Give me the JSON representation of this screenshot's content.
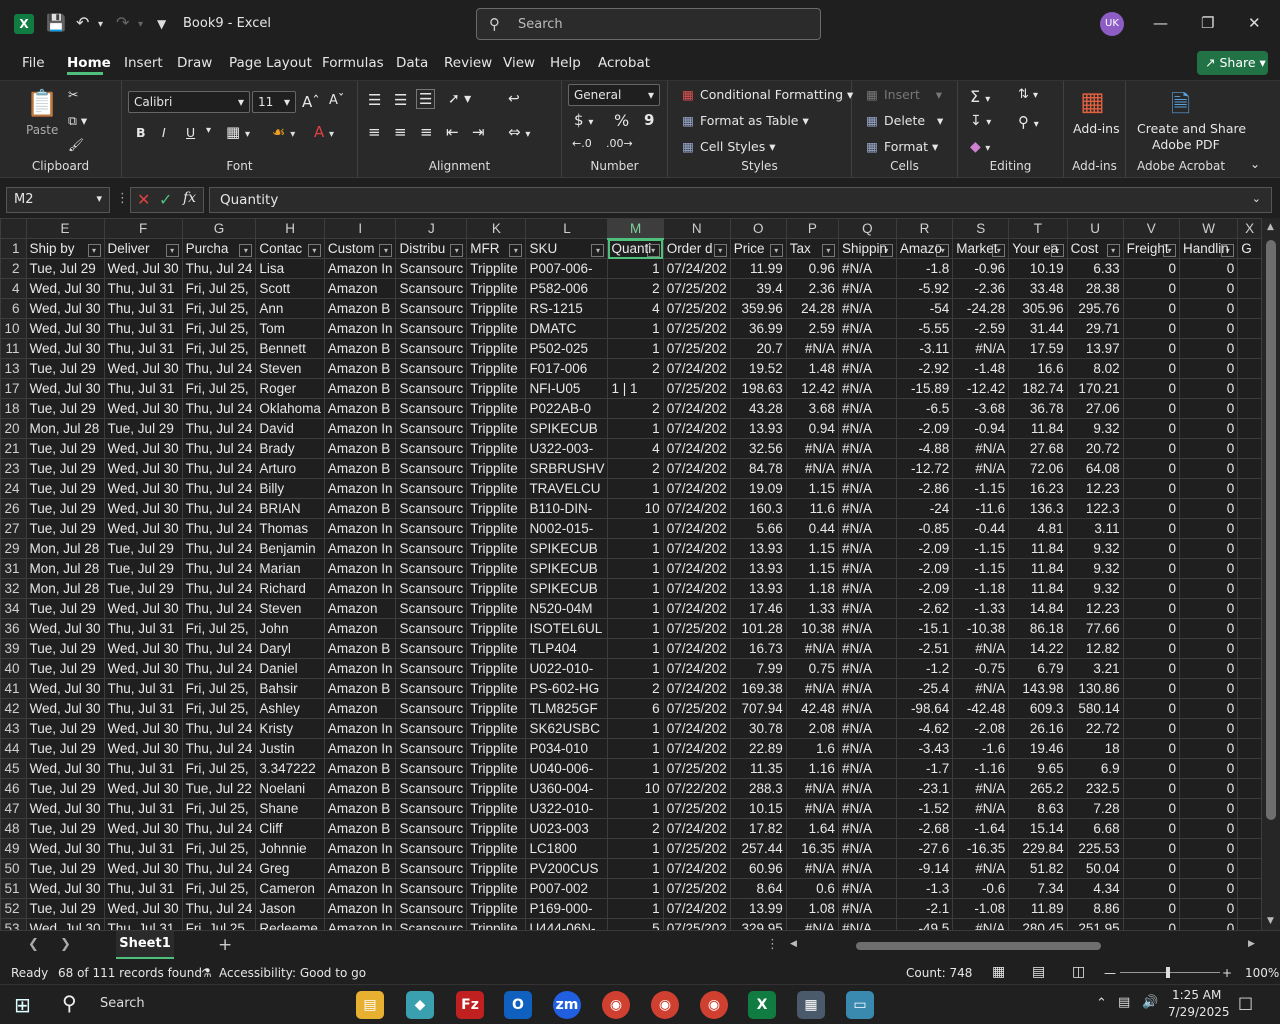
{
  "titlebar": {
    "app_logo": "X",
    "doc_title": "Book9  -  Excel",
    "search_placeholder": "Search",
    "avatar": "UK"
  },
  "menu": {
    "tabs": [
      "File",
      "Home",
      "Insert",
      "Draw",
      "Page Layout",
      "Formulas",
      "Data",
      "Review",
      "View",
      "Help",
      "Acrobat"
    ],
    "share": "Share"
  },
  "ribbon": {
    "clipboard": {
      "paste": "Paste",
      "label": "Clipboard"
    },
    "font": {
      "name": "Calibri",
      "size": "11",
      "bold": "B",
      "italic": "I",
      "underline": "U",
      "label": "Font"
    },
    "alignment": {
      "label": "Alignment"
    },
    "number": {
      "format": "General",
      "currency": "$",
      "percent": "%",
      "comma": "9",
      "label": "Number"
    },
    "styles": {
      "conditional": "Conditional Formatting",
      "format_table": "Format as Table",
      "cell_styles": "Cell Styles",
      "label": "Styles"
    },
    "cells": {
      "insert": "Insert",
      "delete": "Delete",
      "format": "Format",
      "label": "Cells"
    },
    "editing": {
      "label": "Editing"
    },
    "addins": {
      "button": "Add-ins",
      "label": "Add-ins"
    },
    "acrobat": {
      "button_line1": "Create and Share",
      "button_line2": "Adobe PDF",
      "label": "Adobe Acrobat"
    }
  },
  "formula": {
    "namebox": "M2",
    "fx": "fx",
    "value": "Quantity"
  },
  "grid": {
    "columns": [
      "E",
      "F",
      "G",
      "H",
      "I",
      "J",
      "K",
      "L",
      "M",
      "N",
      "O",
      "P",
      "Q",
      "R",
      "S",
      "T",
      "U",
      "V",
      "W",
      "X"
    ],
    "header_row_num": "1",
    "headers": [
      "Ship by",
      "Deliver",
      "Purcha",
      "Contac",
      "Custom",
      "Distribu",
      "MFR",
      "SKU",
      "Quanti",
      "Order d",
      "Price",
      "Tax",
      "Shippin",
      "Amazo",
      "Market",
      "Your ea",
      "Cost",
      "Freight",
      "Handlin",
      "G"
    ],
    "rows": [
      [
        "2",
        "Tue, Jul 29",
        "Wed, Jul 30",
        "Thu, Jul 24",
        "Lisa",
        "Amazon In",
        "Scansourc",
        "Tripplite",
        "P007-006-",
        "1",
        "07/24/202",
        "11.99",
        "0.96",
        "#N/A",
        "-1.8",
        "-0.96",
        "10.19",
        "6.33",
        "0",
        "0"
      ],
      [
        "4",
        "Wed, Jul 30",
        "Thu, Jul 31",
        "Fri, Jul 25,",
        "Scott",
        "Amazon",
        "Scansourc",
        "Tripplite",
        "P582-006",
        "2",
        "07/25/202",
        "39.4",
        "2.36",
        "#N/A",
        "-5.92",
        "-2.36",
        "33.48",
        "28.38",
        "0",
        "0"
      ],
      [
        "6",
        "Wed, Jul 30",
        "Thu, Jul 31",
        "Fri, Jul 25,",
        "Ann",
        "Amazon B",
        "Scansourc",
        "Tripplite",
        "RS-1215",
        "4",
        "07/25/202",
        "359.96",
        "24.28",
        "#N/A",
        "-54",
        "-24.28",
        "305.96",
        "295.76",
        "0",
        "0"
      ],
      [
        "10",
        "Wed, Jul 30",
        "Thu, Jul 31",
        "Fri, Jul 25,",
        "Tom",
        "Amazon In",
        "Scansourc",
        "Tripplite",
        "DMATC",
        "1",
        "07/25/202",
        "36.99",
        "2.59",
        "#N/A",
        "-5.55",
        "-2.59",
        "31.44",
        "29.71",
        "0",
        "0"
      ],
      [
        "11",
        "Wed, Jul 30",
        "Thu, Jul 31",
        "Fri, Jul 25,",
        "Bennett",
        "Amazon B",
        "Scansourc",
        "Tripplite",
        "P502-025",
        "1",
        "07/25/202",
        "20.7",
        "#N/A",
        "#N/A",
        "-3.11",
        "#N/A",
        "17.59",
        "13.97",
        "0",
        "0"
      ],
      [
        "13",
        "Tue, Jul 29",
        "Wed, Jul 30",
        "Thu, Jul 24",
        "Steven",
        "Amazon B",
        "Scansourc",
        "Tripplite",
        "F017-006",
        "2",
        "07/24/202",
        "19.52",
        "1.48",
        "#N/A",
        "-2.92",
        "-1.48",
        "16.6",
        "8.02",
        "0",
        "0"
      ],
      [
        "17",
        "Wed, Jul 30",
        "Thu, Jul 31",
        "Fri, Jul 25,",
        "Roger",
        "Amazon B",
        "Scansourc",
        "Tripplite",
        "NFI-U05",
        "1 | 1",
        "07/25/202",
        "198.63",
        "12.42",
        "#N/A",
        "-15.89",
        "-12.42",
        "182.74",
        "170.21",
        "0",
        "0"
      ],
      [
        "18",
        "Tue, Jul 29",
        "Wed, Jul 30",
        "Thu, Jul 24",
        "Oklahoma",
        "Amazon B",
        "Scansourc",
        "Tripplite",
        "P022AB-0",
        "2",
        "07/24/202",
        "43.28",
        "3.68",
        "#N/A",
        "-6.5",
        "-3.68",
        "36.78",
        "27.06",
        "0",
        "0"
      ],
      [
        "20",
        "Mon, Jul 28",
        "Tue, Jul 29",
        "Thu, Jul 24",
        "David",
        "Amazon In",
        "Scansourc",
        "Tripplite",
        "SPIKECUB",
        "1",
        "07/24/202",
        "13.93",
        "0.94",
        "#N/A",
        "-2.09",
        "-0.94",
        "11.84",
        "9.32",
        "0",
        "0"
      ],
      [
        "21",
        "Tue, Jul 29",
        "Wed, Jul 30",
        "Thu, Jul 24",
        "Brady",
        "Amazon B",
        "Scansourc",
        "Tripplite",
        "U322-003-",
        "4",
        "07/24/202",
        "32.56",
        "#N/A",
        "#N/A",
        "-4.88",
        "#N/A",
        "27.68",
        "20.72",
        "0",
        "0"
      ],
      [
        "23",
        "Tue, Jul 29",
        "Wed, Jul 30",
        "Thu, Jul 24",
        "Arturo",
        "Amazon B",
        "Scansourc",
        "Tripplite",
        "SRBRUSHV",
        "2",
        "07/24/202",
        "84.78",
        "#N/A",
        "#N/A",
        "-12.72",
        "#N/A",
        "72.06",
        "64.08",
        "0",
        "0"
      ],
      [
        "24",
        "Tue, Jul 29",
        "Wed, Jul 30",
        "Thu, Jul 24",
        "Billy",
        "Amazon In",
        "Scansourc",
        "Tripplite",
        "TRAVELCU",
        "1",
        "07/24/202",
        "19.09",
        "1.15",
        "#N/A",
        "-2.86",
        "-1.15",
        "16.23",
        "12.23",
        "0",
        "0"
      ],
      [
        "26",
        "Tue, Jul 29",
        "Wed, Jul 30",
        "Thu, Jul 24",
        "BRIAN",
        "Amazon B",
        "Scansourc",
        "Tripplite",
        "B110-DIN-",
        "10",
        "07/24/202",
        "160.3",
        "11.6",
        "#N/A",
        "-24",
        "-11.6",
        "136.3",
        "122.3",
        "0",
        "0"
      ],
      [
        "27",
        "Tue, Jul 29",
        "Wed, Jul 30",
        "Thu, Jul 24",
        "Thomas",
        "Amazon In",
        "Scansourc",
        "Tripplite",
        "N002-015-",
        "1",
        "07/24/202",
        "5.66",
        "0.44",
        "#N/A",
        "-0.85",
        "-0.44",
        "4.81",
        "3.11",
        "0",
        "0"
      ],
      [
        "29",
        "Mon, Jul 28",
        "Tue, Jul 29",
        "Thu, Jul 24",
        "Benjamin",
        "Amazon In",
        "Scansourc",
        "Tripplite",
        "SPIKECUB",
        "1",
        "07/24/202",
        "13.93",
        "1.15",
        "#N/A",
        "-2.09",
        "-1.15",
        "11.84",
        "9.32",
        "0",
        "0"
      ],
      [
        "31",
        "Mon, Jul 28",
        "Tue, Jul 29",
        "Thu, Jul 24",
        "Marian",
        "Amazon In",
        "Scansourc",
        "Tripplite",
        "SPIKECUB",
        "1",
        "07/24/202",
        "13.93",
        "1.15",
        "#N/A",
        "-2.09",
        "-1.15",
        "11.84",
        "9.32",
        "0",
        "0"
      ],
      [
        "32",
        "Mon, Jul 28",
        "Tue, Jul 29",
        "Thu, Jul 24",
        "Richard",
        "Amazon In",
        "Scansourc",
        "Tripplite",
        "SPIKECUB",
        "1",
        "07/24/202",
        "13.93",
        "1.18",
        "#N/A",
        "-2.09",
        "-1.18",
        "11.84",
        "9.32",
        "0",
        "0"
      ],
      [
        "34",
        "Tue, Jul 29",
        "Wed, Jul 30",
        "Thu, Jul 24",
        "Steven",
        "Amazon",
        "Scansourc",
        "Tripplite",
        "N520-04M",
        "1",
        "07/24/202",
        "17.46",
        "1.33",
        "#N/A",
        "-2.62",
        "-1.33",
        "14.84",
        "12.23",
        "0",
        "0"
      ],
      [
        "36",
        "Wed, Jul 30",
        "Thu, Jul 31",
        "Fri, Jul 25,",
        "John",
        "Amazon",
        "Scansourc",
        "Tripplite",
        "ISOTEL6UL",
        "1",
        "07/25/202",
        "101.28",
        "10.38",
        "#N/A",
        "-15.1",
        "-10.38",
        "86.18",
        "77.66",
        "0",
        "0"
      ],
      [
        "39",
        "Tue, Jul 29",
        "Wed, Jul 30",
        "Thu, Jul 24",
        "Daryl",
        "Amazon B",
        "Scansourc",
        "Tripplite",
        "TLP404",
        "1",
        "07/24/202",
        "16.73",
        "#N/A",
        "#N/A",
        "-2.51",
        "#N/A",
        "14.22",
        "12.82",
        "0",
        "0"
      ],
      [
        "40",
        "Tue, Jul 29",
        "Wed, Jul 30",
        "Thu, Jul 24",
        "Daniel",
        "Amazon In",
        "Scansourc",
        "Tripplite",
        "U022-010-",
        "1",
        "07/24/202",
        "7.99",
        "0.75",
        "#N/A",
        "-1.2",
        "-0.75",
        "6.79",
        "3.21",
        "0",
        "0"
      ],
      [
        "41",
        "Wed, Jul 30",
        "Thu, Jul 31",
        "Fri, Jul 25,",
        "Bahsir",
        "Amazon B",
        "Scansourc",
        "Tripplite",
        "PS-602-HG",
        "2",
        "07/24/202",
        "169.38",
        "#N/A",
        "#N/A",
        "-25.4",
        "#N/A",
        "143.98",
        "130.86",
        "0",
        "0"
      ],
      [
        "42",
        "Wed, Jul 30",
        "Thu, Jul 31",
        "Fri, Jul 25,",
        "Ashley",
        "Amazon",
        "Scansourc",
        "Tripplite",
        "TLM825GF",
        "6",
        "07/25/202",
        "707.94",
        "42.48",
        "#N/A",
        "-98.64",
        "-42.48",
        "609.3",
        "580.14",
        "0",
        "0"
      ],
      [
        "43",
        "Tue, Jul 29",
        "Wed, Jul 30",
        "Thu, Jul 24",
        "Kristy",
        "Amazon In",
        "Scansourc",
        "Tripplite",
        "SK62USBC",
        "1",
        "07/24/202",
        "30.78",
        "2.08",
        "#N/A",
        "-4.62",
        "-2.08",
        "26.16",
        "22.72",
        "0",
        "0"
      ],
      [
        "44",
        "Tue, Jul 29",
        "Wed, Jul 30",
        "Thu, Jul 24",
        "Justin",
        "Amazon In",
        "Scansourc",
        "Tripplite",
        "P034-010",
        "1",
        "07/24/202",
        "22.89",
        "1.6",
        "#N/A",
        "-3.43",
        "-1.6",
        "19.46",
        "18",
        "0",
        "0"
      ],
      [
        "45",
        "Wed, Jul 30",
        "Thu, Jul 31",
        "Fri, Jul 25,",
        "3.347222",
        "Amazon B",
        "Scansourc",
        "Tripplite",
        "U040-006-",
        "1",
        "07/25/202",
        "11.35",
        "1.16",
        "#N/A",
        "-1.7",
        "-1.16",
        "9.65",
        "6.9",
        "0",
        "0"
      ],
      [
        "46",
        "Tue, Jul 29",
        "Wed, Jul 30",
        "Tue, Jul 22",
        "Noelani",
        "Amazon B",
        "Scansourc",
        "Tripplite",
        "U360-004-",
        "10",
        "07/22/202",
        "288.3",
        "#N/A",
        "#N/A",
        "-23.1",
        "#N/A",
        "265.2",
        "232.5",
        "0",
        "0"
      ],
      [
        "47",
        "Wed, Jul 30",
        "Thu, Jul 31",
        "Fri, Jul 25,",
        "Shane",
        "Amazon B",
        "Scansourc",
        "Tripplite",
        "U322-010-",
        "1",
        "07/25/202",
        "10.15",
        "#N/A",
        "#N/A",
        "-1.52",
        "#N/A",
        "8.63",
        "7.28",
        "0",
        "0"
      ],
      [
        "48",
        "Tue, Jul 29",
        "Wed, Jul 30",
        "Thu, Jul 24",
        "Cliff",
        "Amazon B",
        "Scansourc",
        "Tripplite",
        "U023-003",
        "2",
        "07/24/202",
        "17.82",
        "1.64",
        "#N/A",
        "-2.68",
        "-1.64",
        "15.14",
        "6.68",
        "0",
        "0"
      ],
      [
        "49",
        "Wed, Jul 30",
        "Thu, Jul 31",
        "Fri, Jul 25,",
        "Johnnie",
        "Amazon In",
        "Scansourc",
        "Tripplite",
        "LC1800",
        "1",
        "07/25/202",
        "257.44",
        "16.35",
        "#N/A",
        "-27.6",
        "-16.35",
        "229.84",
        "225.53",
        "0",
        "0"
      ],
      [
        "50",
        "Tue, Jul 29",
        "Wed, Jul 30",
        "Thu, Jul 24",
        "Greg",
        "Amazon B",
        "Scansourc",
        "Tripplite",
        "PV200CUS",
        "1",
        "07/24/202",
        "60.96",
        "#N/A",
        "#N/A",
        "-9.14",
        "#N/A",
        "51.82",
        "50.04",
        "0",
        "0"
      ],
      [
        "51",
        "Wed, Jul 30",
        "Thu, Jul 31",
        "Fri, Jul 25,",
        "Cameron",
        "Amazon In",
        "Scansourc",
        "Tripplite",
        "P007-002",
        "1",
        "07/25/202",
        "8.64",
        "0.6",
        "#N/A",
        "-1.3",
        "-0.6",
        "7.34",
        "4.34",
        "0",
        "0"
      ],
      [
        "52",
        "Tue, Jul 29",
        "Wed, Jul 30",
        "Thu, Jul 24",
        "Jason",
        "Amazon In",
        "Scansourc",
        "Tripplite",
        "P169-000-",
        "1",
        "07/24/202",
        "13.99",
        "1.08",
        "#N/A",
        "-2.1",
        "-1.08",
        "11.89",
        "8.86",
        "0",
        "0"
      ],
      [
        "53",
        "Wed, Jul 30",
        "Thu, Jul 31",
        "Fri, Jul 25,",
        "Redeeme",
        "Amazon In",
        "Scansourc",
        "Tripplite",
        "U444-06N-",
        "5",
        "07/25/202",
        "329.95",
        "#N/A",
        "#N/A",
        "-49.5",
        "#N/A",
        "280.45",
        "251.95",
        "0",
        "0"
      ]
    ]
  },
  "sheets": {
    "active": "Sheet1",
    "add": "+"
  },
  "status": {
    "ready": "Ready",
    "records": "68 of 111 records found",
    "accessibility": "Accessibility: Good to go",
    "count": "Count: 748",
    "zoom": "100%"
  },
  "taskbar": {
    "search": "Search",
    "time": "1:25 AM",
    "date": "7/29/2025"
  },
  "colors": {
    "accent": "#4ec07b",
    "excel_green": "#107c41",
    "share": "#217346"
  }
}
